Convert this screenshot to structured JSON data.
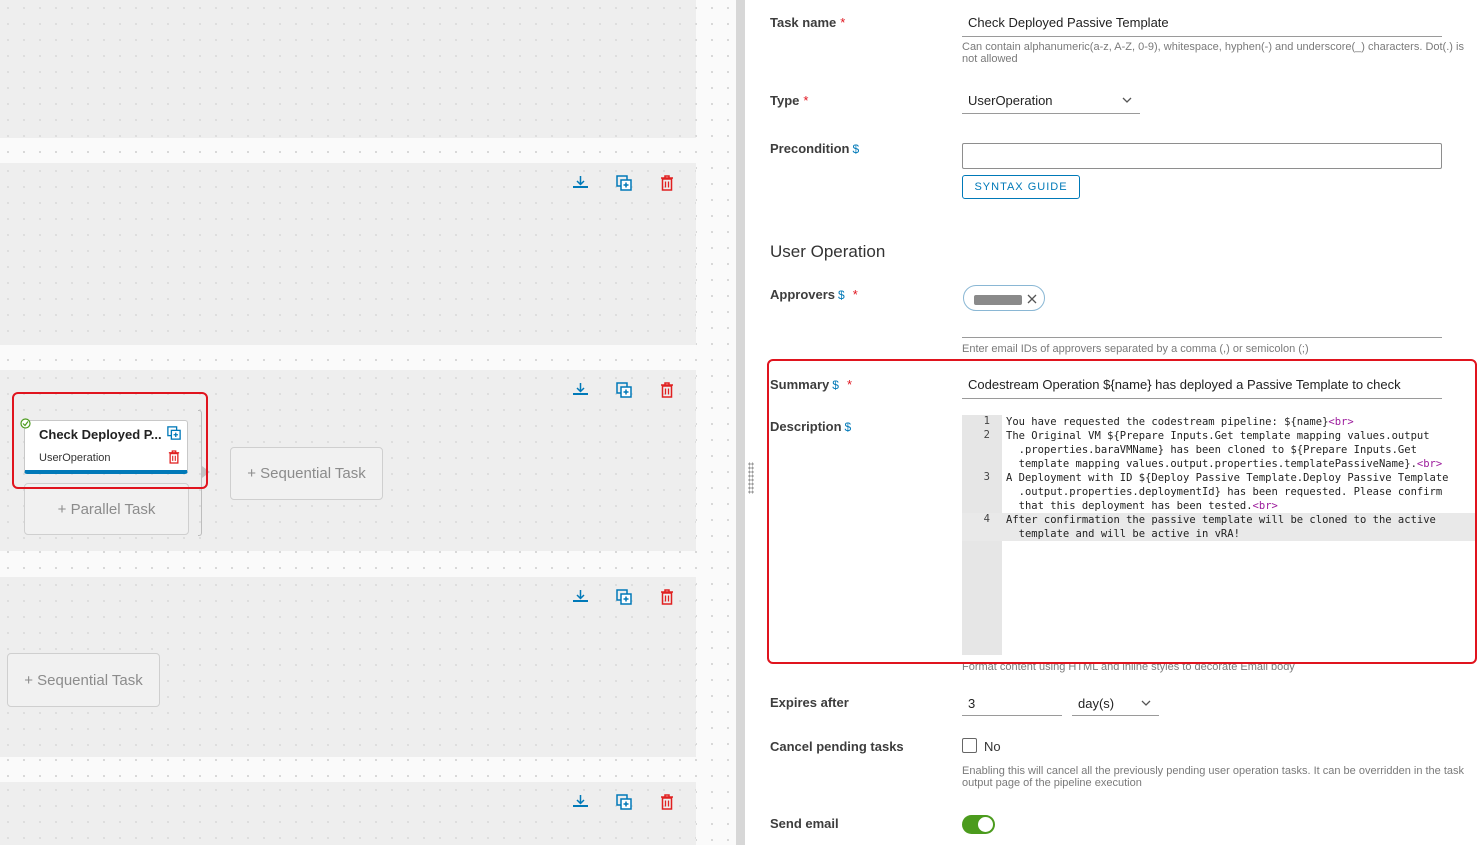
{
  "canvas": {
    "task_card": {
      "title": "Check Deployed P...",
      "type": "UserOperation"
    },
    "parallel_task_label": "+ Parallel Task",
    "sequential_task_label": "+ Sequential Task",
    "sequential_task_label_2": "+ Sequential Task"
  },
  "form": {
    "task_name": {
      "label": "Task name",
      "required_mark": "*",
      "value": "Check Deployed Passive Template",
      "help": "Can contain alphanumeric(a-z, A-Z, 0-9), whitespace, hyphen(-) and underscore(_) characters. Dot(.) is not allowed"
    },
    "type": {
      "label": "Type",
      "required_mark": "*",
      "value": "UserOperation"
    },
    "precondition": {
      "label": "Precondition",
      "dollar": "$",
      "value": "",
      "syntax_button": "SYNTAX GUIDE"
    },
    "user_operation_title": "User Operation",
    "approvers": {
      "label": "Approvers",
      "dollar": "$",
      "required_mark": "*",
      "help": "Enter email IDs of approvers separated by a comma (,) or semicolon (;)"
    },
    "summary": {
      "label": "Summary",
      "dollar": "$",
      "required_mark": "*",
      "value": "Codestream Operation ${name} has deployed a Passive Template to check"
    },
    "description": {
      "label": "Description",
      "dollar": "$",
      "lines": [
        {
          "num": "1",
          "text": "You have requested the codestream pipeline: ${name}",
          "tag": "<br>"
        },
        {
          "num": "2",
          "text": "The Original VM ${Prepare Inputs.Get template mapping values.output\n  .properties.baraVMName} has been cloned to ${Prepare Inputs.Get\n  template mapping values.output.properties.templatePassiveName}.",
          "tag": "<br>"
        },
        {
          "num": "3",
          "text": "A Deployment with ID ${Deploy Passive Template.Deploy Passive Template\n  .output.properties.deploymentId} has been requested. Please confirm\n  that this deployment has been tested.",
          "tag": "<br>"
        },
        {
          "num": "4",
          "text": "After confirmation the passive template will be cloned to the active\n  template and will be active in vRA!",
          "tag": ""
        }
      ],
      "help": "Format content using HTML and inline styles to decorate Email body"
    },
    "expires_after": {
      "label": "Expires after",
      "value": "3",
      "unit": "day(s)"
    },
    "cancel_pending": {
      "label": "Cancel pending tasks",
      "value": "No",
      "help": "Enabling this will cancel all the previously pending user operation tasks. It can be overridden in the task output page of the pipeline execution"
    },
    "send_email": {
      "label": "Send email",
      "enabled": true
    }
  },
  "colors": {
    "accent": "#0079b8",
    "required": "#e0141e",
    "delete": "#e02020",
    "toggle_on": "#4b9b1d",
    "highlight_box": "#e0141e"
  }
}
